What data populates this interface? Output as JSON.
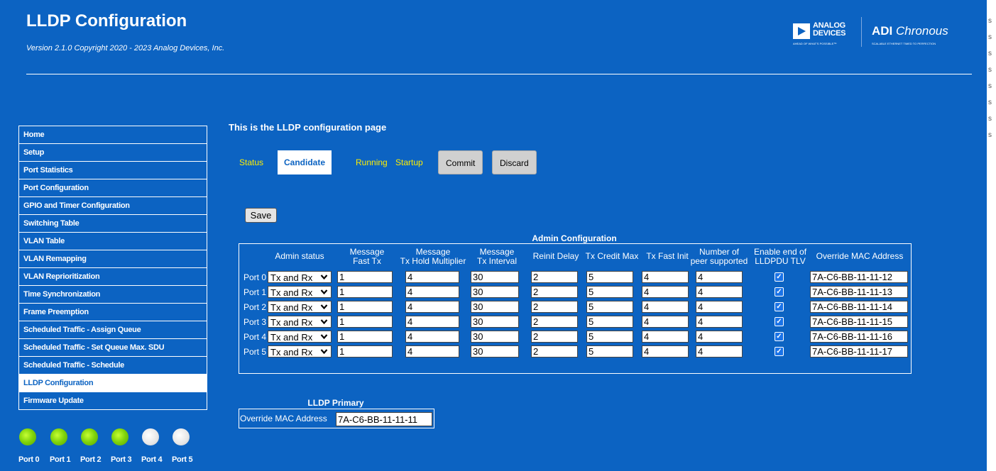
{
  "header": {
    "title": "LLDP Configuration",
    "version": "Version 2.1.0 Copyright 2020 - 2023 Analog Devices, Inc.",
    "logo_analog_name": "ANALOG DEVICES",
    "logo_analog_tagline": "AHEAD OF WHAT'S POSSIBLE™",
    "logo_chronous_brand": "ADI",
    "logo_chronous_name": "Chronous",
    "logo_chronous_tagline": "SCALABLE ETHERNET TIMED TO PERFECTION"
  },
  "sidebar": {
    "items": [
      {
        "label": "Home"
      },
      {
        "label": "Setup"
      },
      {
        "label": "Port Statistics"
      },
      {
        "label": "Port Configuration"
      },
      {
        "label": "GPIO and Timer Configuration"
      },
      {
        "label": "Switching Table"
      },
      {
        "label": "VLAN Table"
      },
      {
        "label": "VLAN Remapping"
      },
      {
        "label": "VLAN Reprioritization"
      },
      {
        "label": "Time Synchronization"
      },
      {
        "label": "Frame Preemption"
      },
      {
        "label": "Scheduled Traffic - Assign Queue"
      },
      {
        "label": "Scheduled Traffic - Set Queue Max. SDU"
      },
      {
        "label": "Scheduled Traffic - Schedule"
      },
      {
        "label": "LLDP Configuration",
        "active": true
      },
      {
        "label": "Firmware Update"
      }
    ]
  },
  "port_leds": [
    {
      "label": "Port 0",
      "state": "on"
    },
    {
      "label": "Port 1",
      "state": "on"
    },
    {
      "label": "Port 2",
      "state": "on"
    },
    {
      "label": "Port 3",
      "state": "on"
    },
    {
      "label": "Port 4",
      "state": "off"
    },
    {
      "label": "Port 5",
      "state": "off"
    }
  ],
  "main": {
    "heading": "This is the LLDP configuration page",
    "tabs": {
      "status": "Status",
      "candidate": "Candidate",
      "running": "Running",
      "startup": "Startup",
      "commit": "Commit",
      "discard": "Discard"
    },
    "save_label": "Save"
  },
  "admin_config": {
    "caption": "Admin Configuration",
    "headers": {
      "admin_status": "Admin status",
      "msg_fast_tx_1": "Message",
      "msg_fast_tx_2": "Fast Tx",
      "msg_hold_1": "Message",
      "msg_hold_2": "Tx Hold Multiplier",
      "msg_interval_1": "Message",
      "msg_interval_2": "Tx Interval",
      "reinit_delay": "Reinit Delay",
      "tx_credit_max": "Tx Credit Max",
      "tx_fast_init": "Tx Fast Init",
      "peers_1": "Number of",
      "peers_2": "peer supported",
      "eol_tlv_1": "Enable end of",
      "eol_tlv_2": "LLDPDU TLV",
      "override_mac": "Override MAC Address"
    },
    "rows": [
      {
        "port": "Port 0",
        "admin_status": "Tx and Rx",
        "msg_fast_tx": "1",
        "msg_tx_hold": "4",
        "msg_tx_interval": "30",
        "reinit_delay": "2",
        "tx_credit_max": "5",
        "tx_fast_init": "4",
        "peers": "4",
        "eol_tlv": true,
        "mac": "7A-C6-BB-11-11-12"
      },
      {
        "port": "Port 1",
        "admin_status": "Tx and Rx",
        "msg_fast_tx": "1",
        "msg_tx_hold": "4",
        "msg_tx_interval": "30",
        "reinit_delay": "2",
        "tx_credit_max": "5",
        "tx_fast_init": "4",
        "peers": "4",
        "eol_tlv": true,
        "mac": "7A-C6-BB-11-11-13"
      },
      {
        "port": "Port 2",
        "admin_status": "Tx and Rx",
        "msg_fast_tx": "1",
        "msg_tx_hold": "4",
        "msg_tx_interval": "30",
        "reinit_delay": "2",
        "tx_credit_max": "5",
        "tx_fast_init": "4",
        "peers": "4",
        "eol_tlv": true,
        "mac": "7A-C6-BB-11-11-14"
      },
      {
        "port": "Port 3",
        "admin_status": "Tx and Rx",
        "msg_fast_tx": "1",
        "msg_tx_hold": "4",
        "msg_tx_interval": "30",
        "reinit_delay": "2",
        "tx_credit_max": "5",
        "tx_fast_init": "4",
        "peers": "4",
        "eol_tlv": true,
        "mac": "7A-C6-BB-11-11-15"
      },
      {
        "port": "Port 4",
        "admin_status": "Tx and Rx",
        "msg_fast_tx": "1",
        "msg_tx_hold": "4",
        "msg_tx_interval": "30",
        "reinit_delay": "2",
        "tx_credit_max": "5",
        "tx_fast_init": "4",
        "peers": "4",
        "eol_tlv": true,
        "mac": "7A-C6-BB-11-11-16"
      },
      {
        "port": "Port 5",
        "admin_status": "Tx and Rx",
        "msg_fast_tx": "1",
        "msg_tx_hold": "4",
        "msg_tx_interval": "30",
        "reinit_delay": "2",
        "tx_credit_max": "5",
        "tx_fast_init": "4",
        "peers": "4",
        "eol_tlv": true,
        "mac": "7A-C6-BB-11-11-17"
      }
    ]
  },
  "lldp_primary": {
    "caption": "LLDP Primary",
    "label": "Override MAC Address",
    "mac": "7A-C6-BB-11-11-11"
  },
  "colors": {
    "background": "#0c63c2",
    "link_yellow": "#ffee00",
    "led_on": "#7dd10a",
    "led_off": "#e6e6e6"
  }
}
